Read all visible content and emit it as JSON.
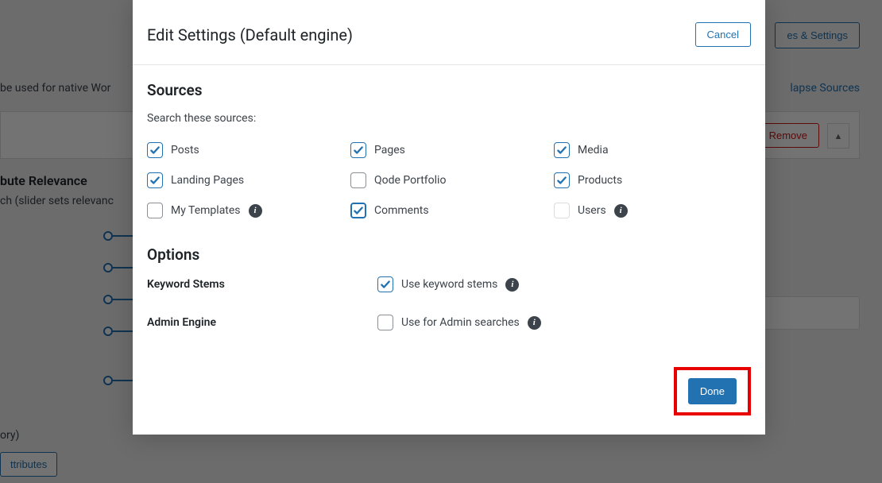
{
  "background": {
    "topButton": "es & Settings",
    "bgText": "be used for native Wor",
    "collapse": "lapse Sources",
    "remove": "Remove",
    "relevanceTitle": "bute Relevance",
    "relevanceSub": "ch (slider sets relevanc",
    "ory": "ory)",
    "attrBtn": "ttributes"
  },
  "modal": {
    "title": "Edit Settings (Default engine)",
    "cancel": "Cancel",
    "done": "Done",
    "sources": {
      "heading": "Sources",
      "sub": "Search these sources:",
      "items": [
        {
          "label": "Posts",
          "checked": true,
          "info": false,
          "disabled": false,
          "primary": false
        },
        {
          "label": "Pages",
          "checked": true,
          "info": false,
          "disabled": false,
          "primary": false
        },
        {
          "label": "Media",
          "checked": true,
          "info": false,
          "disabled": false,
          "primary": false
        },
        {
          "label": "Landing Pages",
          "checked": true,
          "info": false,
          "disabled": false,
          "primary": false
        },
        {
          "label": "Qode Portfolio",
          "checked": false,
          "info": false,
          "disabled": false,
          "primary": false
        },
        {
          "label": "Products",
          "checked": true,
          "info": false,
          "disabled": false,
          "primary": false
        },
        {
          "label": "My Templates",
          "checked": false,
          "info": true,
          "disabled": false,
          "primary": false
        },
        {
          "label": "Comments",
          "checked": true,
          "info": false,
          "disabled": false,
          "primary": true
        },
        {
          "label": "Users",
          "checked": false,
          "info": true,
          "disabled": true,
          "primary": false
        }
      ]
    },
    "options": {
      "heading": "Options",
      "rows": [
        {
          "label": "Keyword Stems",
          "ctrl": "Use keyword stems",
          "checked": true,
          "info": true
        },
        {
          "label": "Admin Engine",
          "ctrl": "Use for Admin searches",
          "checked": false,
          "info": true
        }
      ]
    }
  }
}
